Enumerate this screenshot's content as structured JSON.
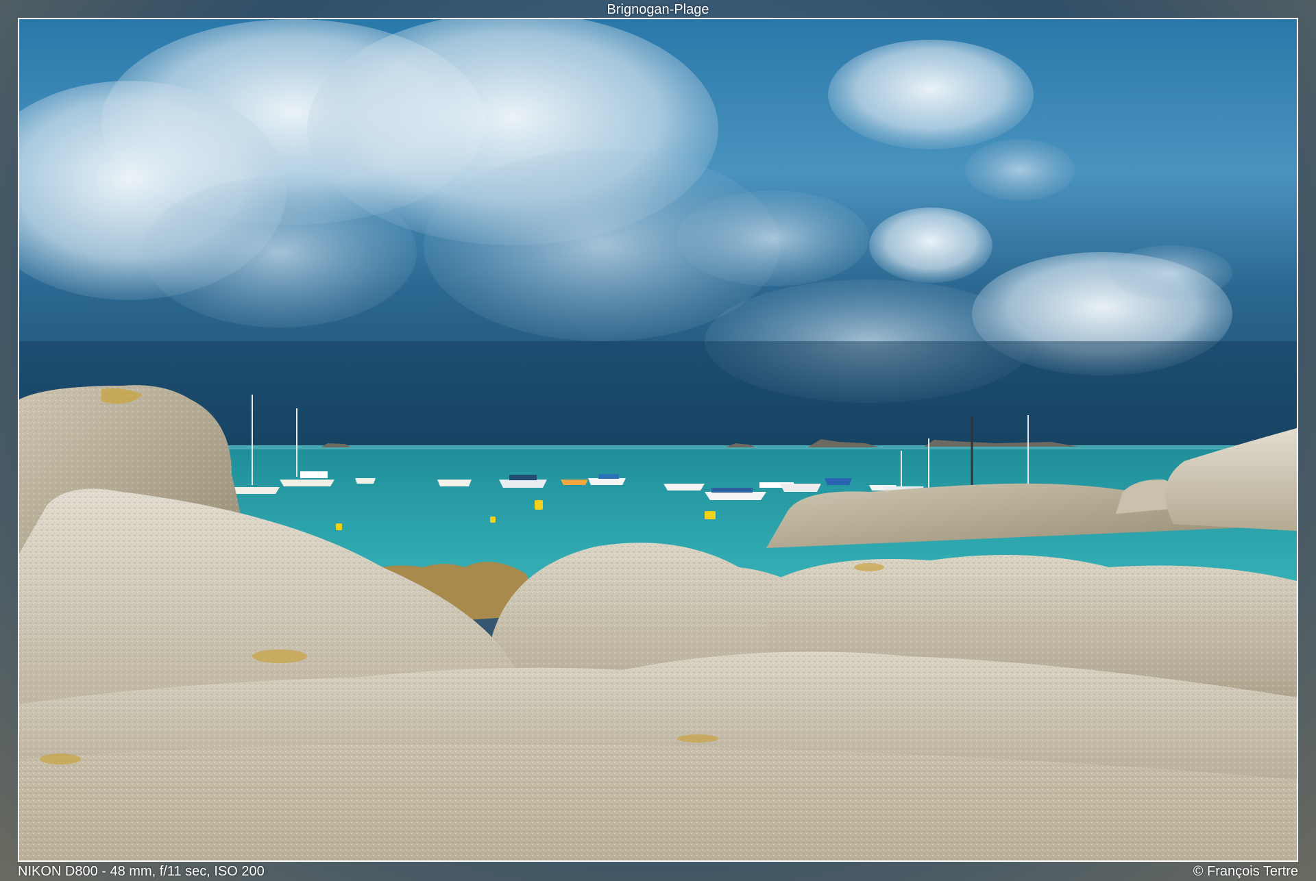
{
  "photo": {
    "title": "Brignogan-Plage",
    "exif": "NIKON D800 - 48 mm, f/11 sec, ISO 200",
    "credit": "© François Tertre"
  },
  "colors": {
    "sky_top": "#1f5f8c",
    "sky_mid": "#3e86b3",
    "storm": "#1b4767",
    "sea": "#2aa3ad",
    "sea_dark": "#1e8591",
    "rock_light": "#d9d2bf",
    "rock_mid": "#b7ad94",
    "rock_dark": "#8c8270",
    "lichen": "#c9a23a",
    "buoy": "#f2d11a",
    "border": "#ffffff"
  }
}
